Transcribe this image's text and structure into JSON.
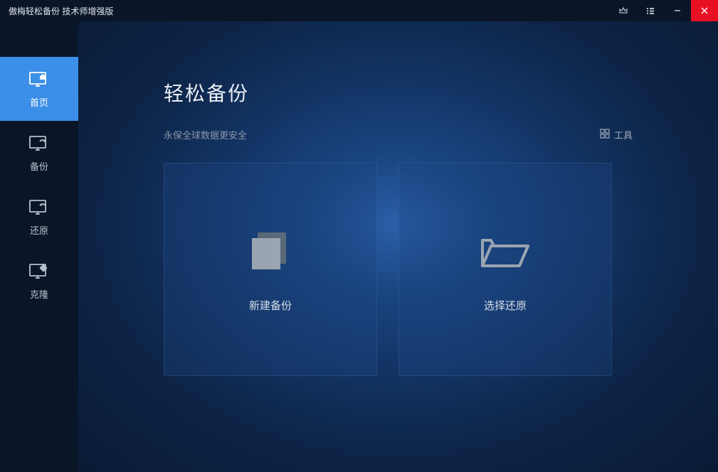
{
  "window": {
    "title": "傲梅轻松备份 技术师增强版"
  },
  "sidebar": {
    "items": [
      {
        "label": "首页"
      },
      {
        "label": "备份"
      },
      {
        "label": "还原"
      },
      {
        "label": "克隆"
      }
    ]
  },
  "main": {
    "title": "轻松备份",
    "subtitle": "永保全球数据更安全",
    "tools_label": "工具",
    "cards": [
      {
        "label": "新建备份"
      },
      {
        "label": "选择还原"
      }
    ]
  }
}
